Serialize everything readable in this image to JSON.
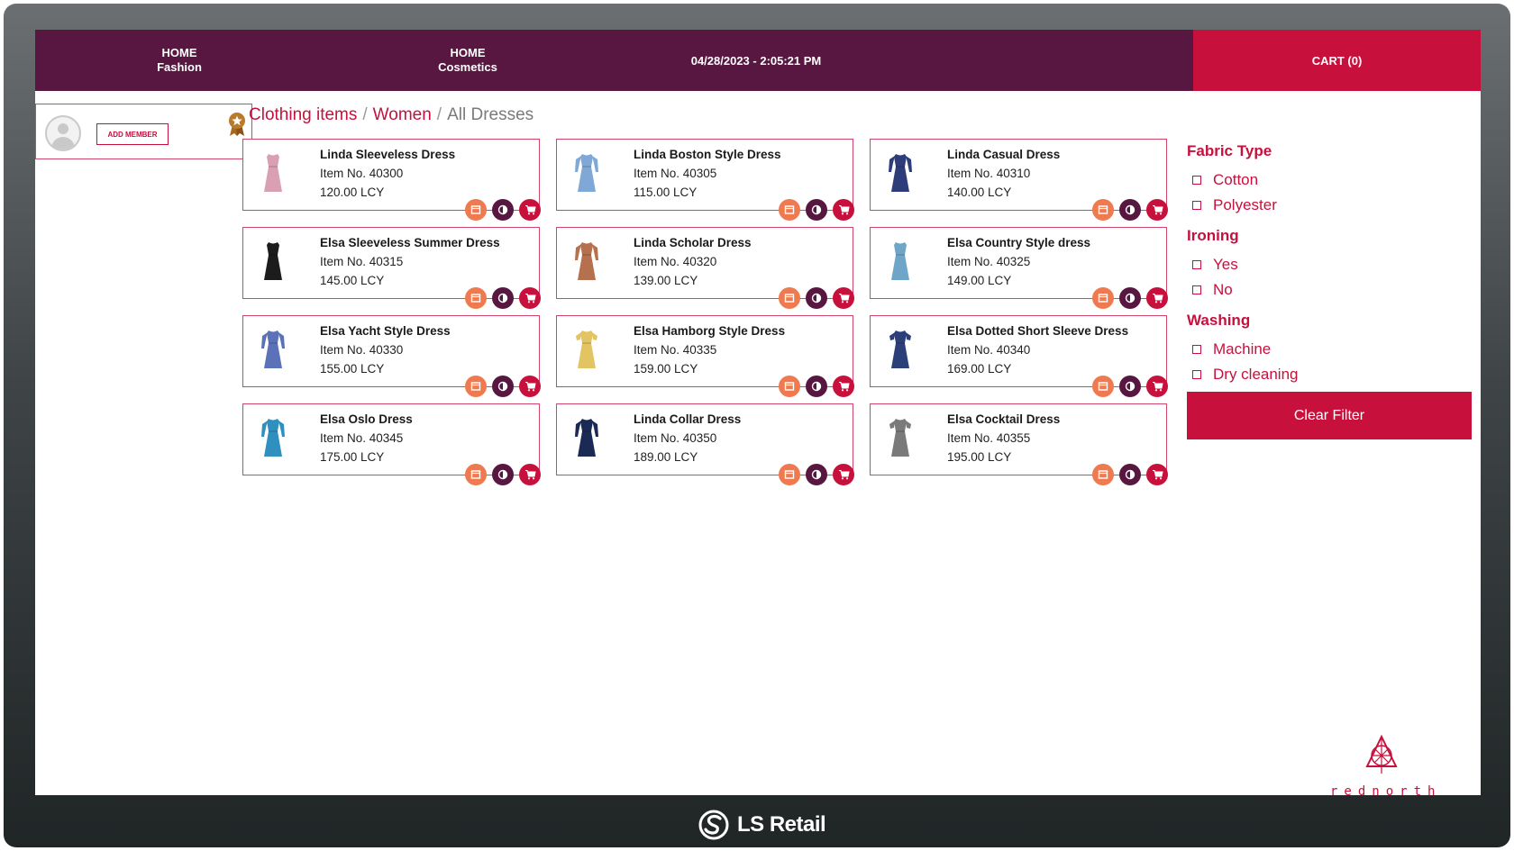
{
  "header": {
    "home_fashion": {
      "line1": "HOME",
      "line2": "Fashion"
    },
    "home_cosmetics": {
      "line1": "HOME",
      "line2": "Cosmetics"
    },
    "datetime": "04/28/2023 - 2:05:21 PM",
    "cart_label": "CART (0)"
  },
  "member": {
    "add_member_label": "ADD MEMBER"
  },
  "breadcrumb": {
    "items": [
      "Clothing items",
      "Women",
      "All Dresses"
    ],
    "separator": "/"
  },
  "products": [
    {
      "name": "Linda Sleeveless Dress",
      "item_no": "Item No. 40300",
      "price": "120.00 LCY",
      "color": "#d9a0b3",
      "shape": "sleeveless"
    },
    {
      "name": "Linda Boston Style Dress",
      "item_no": "Item No. 40305",
      "price": "115.00 LCY",
      "color": "#7fa8d6",
      "shape": "sleeved"
    },
    {
      "name": "Linda Casual Dress",
      "item_no": "Item No. 40310",
      "price": "140.00 LCY",
      "color": "#2e3d7a",
      "shape": "sleeved"
    },
    {
      "name": "Elsa Sleeveless Summer Dress",
      "item_no": "Item No. 40315",
      "price": "145.00 LCY",
      "color": "#1c1c1c",
      "shape": "sleeveless"
    },
    {
      "name": "Linda Scholar Dress",
      "item_no": "Item No. 40320",
      "price": "139.00 LCY",
      "color": "#b5714d",
      "shape": "sleeved"
    },
    {
      "name": "Elsa Country Style dress",
      "item_no": "Item No. 40325",
      "price": "149.00 LCY",
      "color": "#6fa6c8",
      "shape": "sleeveless"
    },
    {
      "name": "Elsa Yacht Style Dress",
      "item_no": "Item No. 40330",
      "price": "155.00 LCY",
      "color": "#5b72b8",
      "shape": "sleeved"
    },
    {
      "name": "Elsa Hamborg Style Dress",
      "item_no": "Item No. 40335",
      "price": "159.00 LCY",
      "color": "#e2c463",
      "shape": "short"
    },
    {
      "name": "Elsa Dotted Short Sleeve Dress",
      "item_no": "Item No. 40340",
      "price": "169.00 LCY",
      "color": "#2d3f78",
      "shape": "short"
    },
    {
      "name": "Elsa Oslo Dress",
      "item_no": "Item No. 40345",
      "price": "175.00 LCY",
      "color": "#2f8fbf",
      "shape": "sleeved"
    },
    {
      "name": "Linda Collar Dress",
      "item_no": "Item No. 40350",
      "price": "189.00 LCY",
      "color": "#1b2a55",
      "shape": "sleeved"
    },
    {
      "name": "Elsa Cocktail Dress",
      "item_no": "Item No. 40355",
      "price": "195.00 LCY",
      "color": "#7a7a7a",
      "shape": "short"
    }
  ],
  "filters": {
    "groups": [
      {
        "heading": "Fabric Type",
        "options": [
          "Cotton",
          "Polyester"
        ]
      },
      {
        "heading": "Ironing",
        "options": [
          "Yes",
          "No"
        ]
      },
      {
        "heading": "Washing",
        "options": [
          "Machine",
          "Dry cleaning"
        ]
      }
    ],
    "clear_label": "Clear Filter"
  },
  "branding": {
    "store_logo_text": "rednorth",
    "footer_brand": "LS Retail"
  },
  "icons": {
    "member_badge": "award-badge-icon",
    "action_1": "details-icon",
    "action_2": "compare-icon",
    "action_3": "add-to-cart-icon"
  },
  "colors": {
    "header_bg": "#571740",
    "accent": "#c8103c",
    "orange": "#f07a4f",
    "card_border": "#d0466a"
  }
}
